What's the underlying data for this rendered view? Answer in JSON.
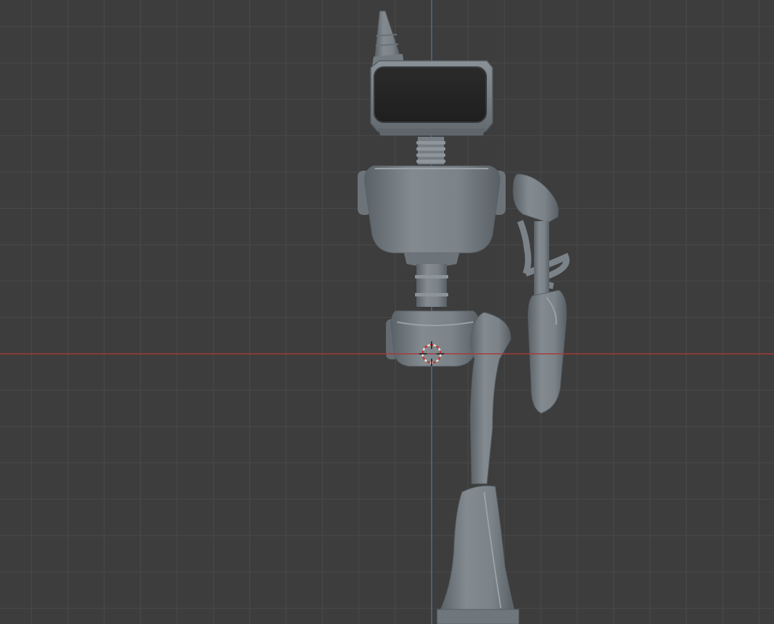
{
  "viewport": {
    "background": "#3d3d3d",
    "grid": {
      "visible": true,
      "minor_color": "#4a4a4a",
      "major_color": "#555555"
    },
    "axes": {
      "x_axis_color": "#a83a3a",
      "z_axis_color": "#4d6c9a"
    },
    "cursor": {
      "icon": "3d-cursor-icon",
      "colors": [
        "#e0e0e0",
        "#c0392b"
      ]
    }
  },
  "model": {
    "name": "robot",
    "material_color": "#7b8389",
    "shadow_color": "#5b6267",
    "highlight_color": "#9aa2a7",
    "screen_color": "#242424",
    "parts": [
      "antenna",
      "head-screen",
      "neck-spring",
      "torso",
      "waist-column",
      "pelvis",
      "shoulder-pad",
      "arm-hose",
      "forearm",
      "leg-upper",
      "leg-lower",
      "foot-base"
    ]
  }
}
